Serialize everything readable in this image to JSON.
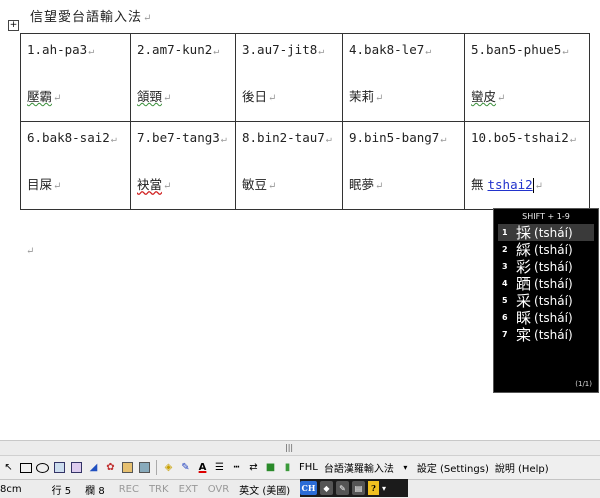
{
  "document": {
    "title": "信望愛台語輸入法",
    "para_mark": "↵",
    "table_handle": "+",
    "rows": [
      [
        {
          "romanization": "1.ah-pa3",
          "hanzi": "壓霸",
          "spell_mark": "green"
        },
        {
          "romanization": "2.am7-kun2",
          "hanzi": "頷頸",
          "spell_mark": "green"
        },
        {
          "romanization": "3.au7-jit8",
          "hanzi": "後日",
          "spell_mark": "none"
        },
        {
          "romanization": "4.bak8-le7",
          "hanzi": "茉莉",
          "spell_mark": "none"
        },
        {
          "romanization": "5.ban5-phue5",
          "hanzi": "蠻皮",
          "spell_mark": "green"
        }
      ],
      [
        {
          "romanization": "6.bak8-sai2",
          "hanzi": "目屎",
          "spell_mark": "none"
        },
        {
          "romanization": "7.be7-tang3",
          "hanzi": "袂當",
          "spell_mark": "red"
        },
        {
          "romanization": "8.bin2-tau7",
          "hanzi": "敏豆",
          "spell_mark": "none"
        },
        {
          "romanization": "9.bin5-bang7",
          "hanzi": "眠夢",
          "spell_mark": "none"
        },
        {
          "romanization": "10.bo5-tshai2",
          "hanzi": "無",
          "composing": "tshai2"
        }
      ]
    ]
  },
  "ime_popup": {
    "header": "SHIFT + 1-9",
    "candidates": [
      {
        "num": "1",
        "char": "採",
        "reading": "(tsháí)",
        "selected": true
      },
      {
        "num": "2",
        "char": "綵",
        "reading": "(tsháí)"
      },
      {
        "num": "3",
        "char": "彩",
        "reading": "(tsháí)"
      },
      {
        "num": "4",
        "char": "跴",
        "reading": "(tsháí)"
      },
      {
        "num": "5",
        "char": "采",
        "reading": "(tsháí)"
      },
      {
        "num": "6",
        "char": "睬",
        "reading": "(tsháí)"
      },
      {
        "num": "7",
        "char": "寀",
        "reading": "(tsháí)"
      }
    ],
    "page": "(1/1)"
  },
  "splitter": {
    "grip": "|||"
  },
  "toolbar": {
    "ime_name": "FHL",
    "ime_title": "台語漢羅輸入法",
    "settings": "設定 (Settings)",
    "help": "說明 (Help)"
  },
  "statusbar": {
    "position": "8cm",
    "line": "行 5",
    "column": "欄 8",
    "rec": "REC",
    "trk": "TRK",
    "ext": "EXT",
    "ovr": "OVR",
    "language": "英文 (美國)"
  },
  "langbar": {
    "mode": "CH",
    "help": "?"
  },
  "colors": {
    "spell_green": "#3a8f3a",
    "spell_red": "#d02020",
    "compose_blue": "#2233cc",
    "popup_bg": "#000000"
  }
}
